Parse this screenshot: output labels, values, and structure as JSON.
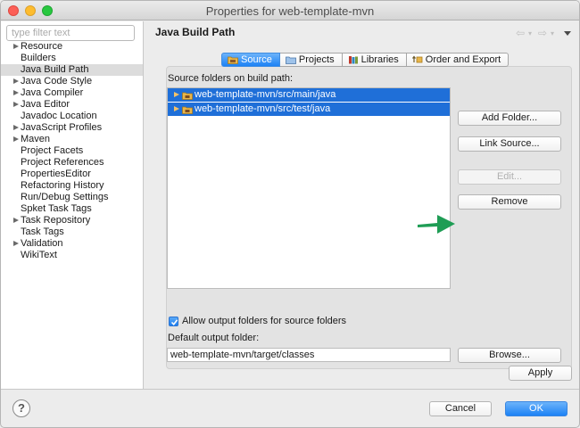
{
  "window": {
    "title": "Properties for web-template-mvn"
  },
  "sidebar": {
    "filter_placeholder": "type filter text",
    "items": [
      {
        "label": "Resource",
        "expandable": true,
        "selected": false
      },
      {
        "label": "Builders",
        "expandable": false,
        "selected": false
      },
      {
        "label": "Java Build Path",
        "expandable": false,
        "selected": true
      },
      {
        "label": "Java Code Style",
        "expandable": true,
        "selected": false
      },
      {
        "label": "Java Compiler",
        "expandable": true,
        "selected": false
      },
      {
        "label": "Java Editor",
        "expandable": true,
        "selected": false
      },
      {
        "label": "Javadoc Location",
        "expandable": false,
        "selected": false
      },
      {
        "label": "JavaScript Profiles",
        "expandable": true,
        "selected": false
      },
      {
        "label": "Maven",
        "expandable": true,
        "selected": false
      },
      {
        "label": "Project Facets",
        "expandable": false,
        "selected": false
      },
      {
        "label": "Project References",
        "expandable": false,
        "selected": false
      },
      {
        "label": "PropertiesEditor",
        "expandable": false,
        "selected": false
      },
      {
        "label": "Refactoring History",
        "expandable": false,
        "selected": false
      },
      {
        "label": "Run/Debug Settings",
        "expandable": false,
        "selected": false
      },
      {
        "label": "Spket Task Tags",
        "expandable": false,
        "selected": false
      },
      {
        "label": "Task Repository",
        "expandable": true,
        "selected": false
      },
      {
        "label": "Task Tags",
        "expandable": false,
        "selected": false
      },
      {
        "label": "Validation",
        "expandable": true,
        "selected": false
      },
      {
        "label": "WikiText",
        "expandable": false,
        "selected": false
      }
    ]
  },
  "page": {
    "title": "Java Build Path",
    "tabs": [
      {
        "label": "Source",
        "icon": "source-folder-icon",
        "active": true
      },
      {
        "label": "Projects",
        "icon": "projects-icon",
        "active": false
      },
      {
        "label": "Libraries",
        "icon": "libraries-icon",
        "active": false
      },
      {
        "label": "Order and Export",
        "icon": "order-export-icon",
        "active": false
      }
    ],
    "source_folders_label": "Source folders on build path:",
    "source_folders": [
      "web-template-mvn/src/main/java",
      "web-template-mvn/src/test/java"
    ],
    "buttons": {
      "add_folder": "Add Folder...",
      "link_source": "Link Source...",
      "edit": "Edit...",
      "remove": "Remove",
      "browse": "Browse..."
    },
    "allow_output_label": "Allow output folders for source folders",
    "allow_output_checked": true,
    "default_output_label": "Default output folder:",
    "default_output_value": "web-template-mvn/target/classes",
    "apply": "Apply"
  },
  "footer": {
    "help": "?",
    "cancel": "Cancel",
    "ok": "OK"
  },
  "colors": {
    "accent": "#1d82f5",
    "selection": "#1f6fd8",
    "annotation_arrow": "#1f9d55"
  }
}
